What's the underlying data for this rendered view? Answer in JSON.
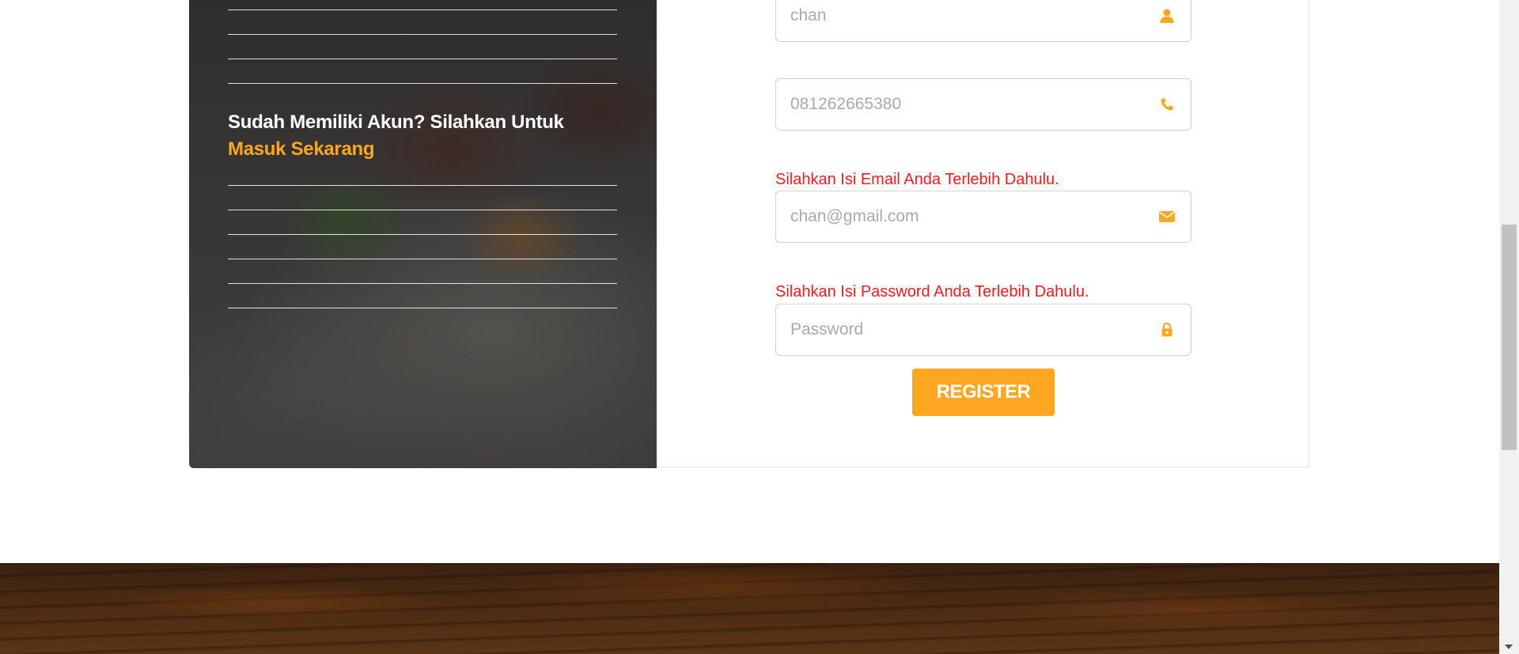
{
  "left_panel": {
    "prompt_text": "Sudah Memiliki Akun? Silahkan Untuk ",
    "login_link": "Masuk Sekarang"
  },
  "form": {
    "name_field": {
      "value": "",
      "placeholder": "chan",
      "icon": "user-icon"
    },
    "phone_field": {
      "value": "",
      "placeholder": "081262665380",
      "icon": "phone-icon"
    },
    "email_error": "Silahkan Isi Email Anda Terlebih Dahulu.",
    "email_field": {
      "value": "",
      "placeholder": "chan@gmail.com",
      "icon": "envelope-icon"
    },
    "password_error": "Silahkan Isi Password Anda Terlebih Dahulu.",
    "password_field": {
      "value": "",
      "placeholder": "Password",
      "icon": "lock-icon"
    },
    "register_label": "REGISTER"
  },
  "colors": {
    "accent": "#ffa622",
    "error": "#ee1c1c"
  }
}
